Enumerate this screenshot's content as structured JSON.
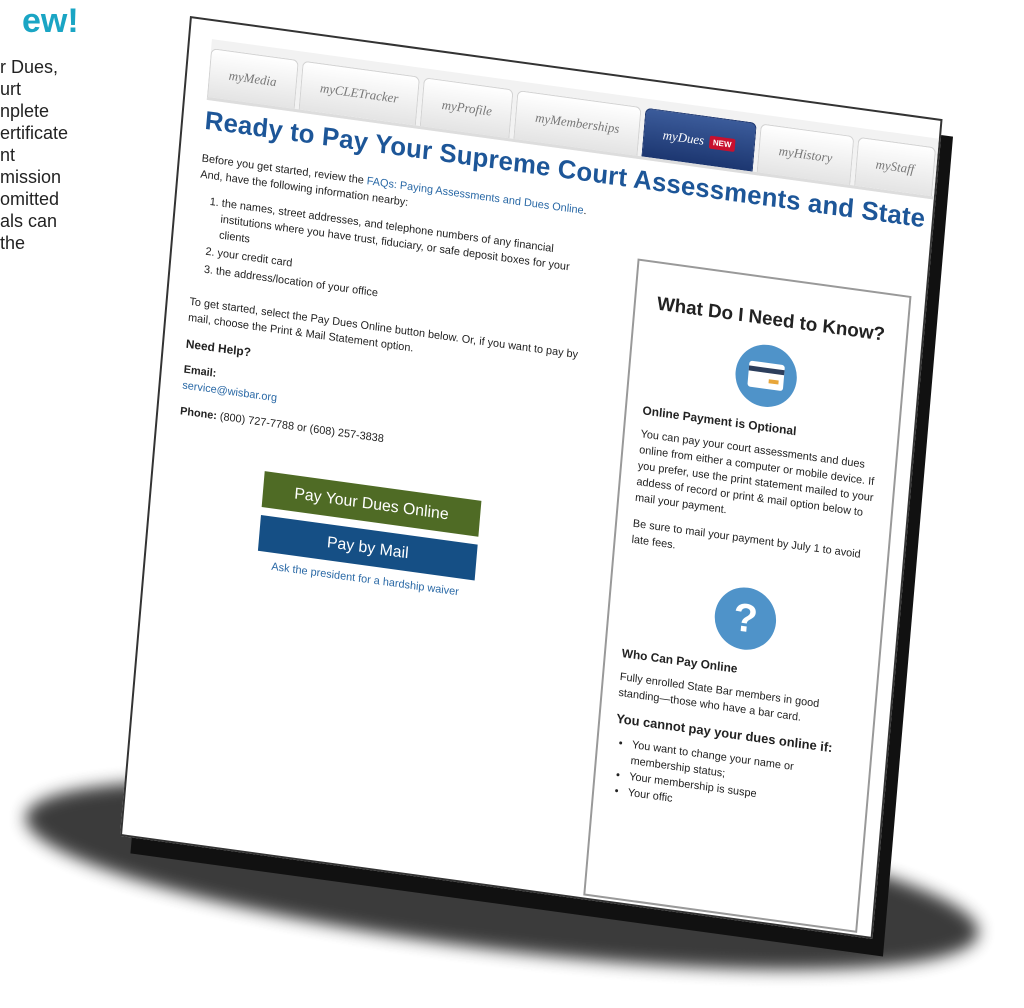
{
  "left_page": {
    "heading": "ew!",
    "lines": [
      "r Dues,",
      "urt",
      "nplete",
      "ertificate",
      "nt",
      "mission",
      "omitted",
      "als can",
      "the"
    ]
  },
  "tabs": [
    {
      "label": "myMedia"
    },
    {
      "label": "myCLETracker"
    },
    {
      "label": "myProfile"
    },
    {
      "label": "myMemberships"
    },
    {
      "label": "myDues",
      "active": true,
      "badge": "NEW"
    },
    {
      "label": "myHistory"
    },
    {
      "label": "myStaff"
    }
  ],
  "main": {
    "title": "Ready to Pay Your Supreme Court Assessments and State Bar Dues?",
    "intro_before": "Before you get started, review the ",
    "intro_link": "FAQs: Paying Assessments and Dues Online",
    "intro_after": ". And, have the following information nearby:",
    "list": [
      "the names, street addresses, and telephone numbers of any financial institutions where you have trust, fiduciary, or safe deposit boxes for your clients",
      "your credit card",
      "the address/location of your office"
    ],
    "get_started": "To get started, select the Pay Dues Online button below. Or, if you want to pay by mail, choose the Print & Mail Statement option.",
    "need_help": "Need Help?",
    "email_label": "Email:",
    "email": "service@wisbar.org",
    "phone_label": "Phone:",
    "phone": "(800) 727-7788 or (608) 257-3838",
    "pay_online_button": "Pay Your Dues Online",
    "pay_mail_button": "Pay by Mail",
    "waiver_link": "Ask the president for a hardship waiver"
  },
  "info_box": {
    "title": "What Do I Need to Know?",
    "section1_title": "Online Payment is Optional",
    "section1_text": "You can pay your court assessments and dues online from either a computer or mobile device. If you prefer, use the print statement mailed to your addess of record or print & mail option below to mail your payment.",
    "section1_note": "Be sure to mail your payment by July 1 to avoid late fees.",
    "section2_title": "Who Can Pay Online",
    "section2_text": "Fully enrolled State Bar members in good standing—those who have a bar card.",
    "section3_title": "You cannot pay your dues online if:",
    "bullets": [
      "You want to change your name or membership status;",
      "Your membership is suspe",
      "Your offic"
    ]
  },
  "colors": {
    "title_blue": "#1d5698",
    "link_blue": "#2a69a6",
    "green_button": "#4f6b25",
    "blue_button": "#154f85",
    "icon_blue": "#4f93c9",
    "active_tab": "#1c3670",
    "badge_red": "#c8102e",
    "teal_heading": "#1aa5c4"
  },
  "icons": [
    "credit-card-icon",
    "question-mark-icon"
  ]
}
